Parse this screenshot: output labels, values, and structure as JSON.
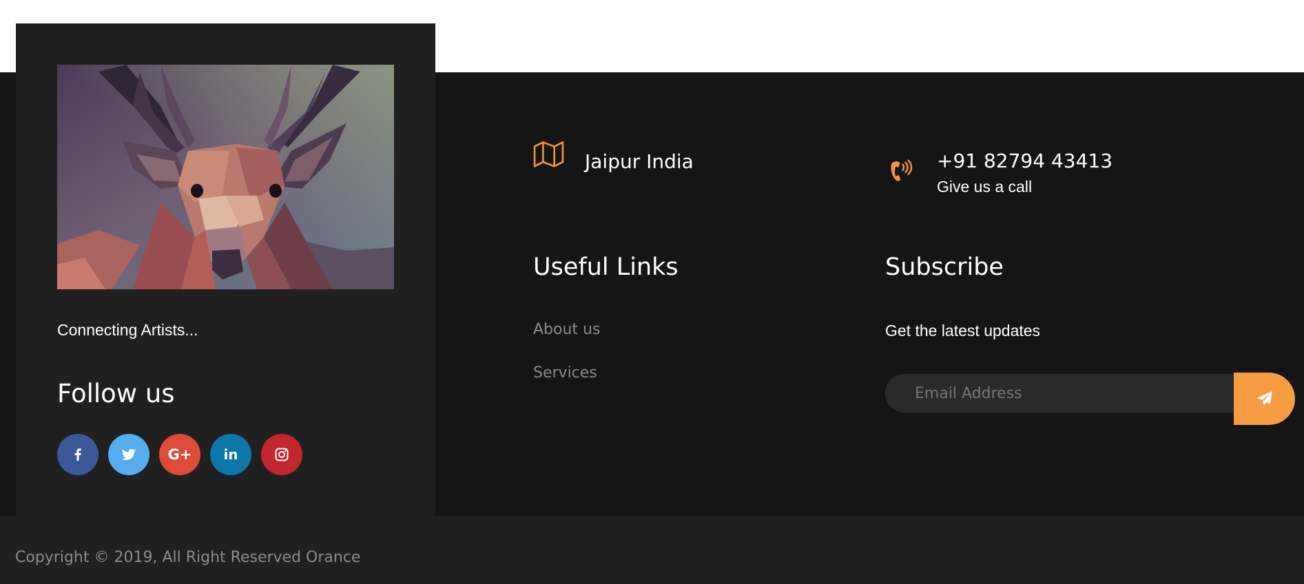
{
  "about": {
    "image_alt": "Low-poly deer artwork",
    "tagline": "Connecting Artists...",
    "follow_title": "Follow us",
    "social": [
      {
        "name": "facebook",
        "color": "#3b5998"
      },
      {
        "name": "twitter",
        "color": "#55acee"
      },
      {
        "name": "google-plus",
        "label": "G+",
        "color": "#dd4b39"
      },
      {
        "name": "linkedin",
        "label": "in",
        "color": "#0e76a8"
      },
      {
        "name": "instagram",
        "color": "#c1272d"
      }
    ]
  },
  "contact": {
    "location": {
      "icon": "map-icon",
      "title": "Jaipur India"
    },
    "phone": {
      "icon": "phone-icon",
      "title": "+91 82794 43413",
      "subtitle": "Give us a call"
    }
  },
  "links": {
    "title": "Useful Links",
    "items": [
      "About us",
      "Services"
    ]
  },
  "subscribe": {
    "title": "Subscribe",
    "text": "Get the latest updates",
    "placeholder": "Email Address",
    "button_icon": "paper-plane-icon"
  },
  "footer": {
    "copyright": "Copyright © 2019, All Right Reserved Orance"
  },
  "colors": {
    "accent": "#f69d44",
    "footer_bg": "#161516",
    "card_bg": "#202020"
  }
}
